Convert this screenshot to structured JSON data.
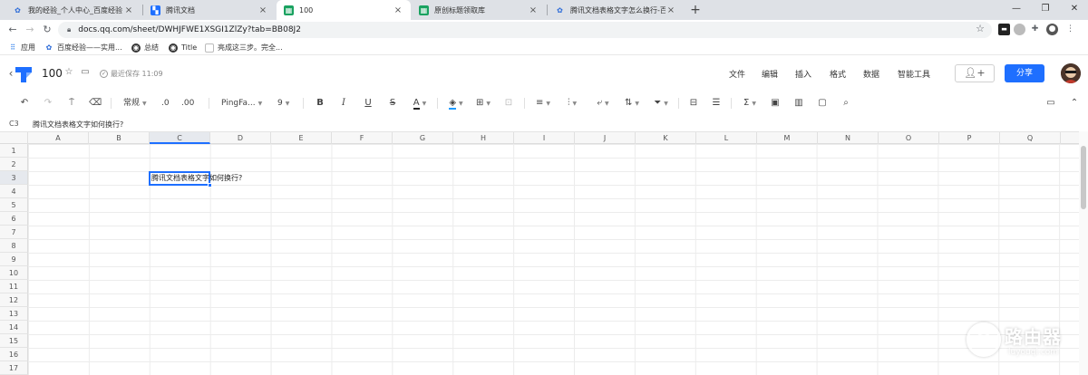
{
  "browser": {
    "tabs": [
      {
        "title": "我的经验_个人中心_百度经验",
        "active": false
      },
      {
        "title": "腾讯文档",
        "active": false
      },
      {
        "title": "100",
        "active": true
      },
      {
        "title": "原创标题领取库",
        "active": false
      },
      {
        "title": "腾讯文档表格文字怎么换行-百度",
        "active": false
      }
    ],
    "url": "docs.qq.com/sheet/DWHJFWE1XSGI1ZlZy?tab=BB08J2",
    "bookmarks": [
      {
        "label": "应用"
      },
      {
        "label": "百度经验——实用..."
      },
      {
        "label": "总结"
      },
      {
        "label": "Title"
      },
      {
        "label": "亮成这三步。完全..."
      }
    ]
  },
  "doc": {
    "title": "100",
    "saved_status": "最近保存 11:09",
    "menus": [
      "文件",
      "编辑",
      "插入",
      "格式",
      "数据",
      "智能工具"
    ],
    "share_label": "分享",
    "accent_color": "#1e6fff"
  },
  "toolbar": {
    "number_format": "常规",
    "decimal_decrease": ".0",
    "decimal_increase": ".00",
    "font_family": "PingFa...",
    "font_size": "9",
    "bold": "B",
    "italic": "I",
    "underline": "U",
    "strike": "S",
    "font_color": "A"
  },
  "formula_bar": {
    "cell_ref": "C3",
    "content": "腾讯文档表格文字如何换行?"
  },
  "sheet": {
    "columns": [
      "A",
      "B",
      "C",
      "D",
      "E",
      "F",
      "G",
      "H",
      "I",
      "J",
      "K",
      "L",
      "M",
      "N",
      "O",
      "P",
      "Q"
    ],
    "rows": [
      "1",
      "2",
      "3",
      "4",
      "5",
      "6",
      "7",
      "8",
      "9",
      "10",
      "11",
      "12",
      "13",
      "14",
      "15",
      "16",
      "17"
    ],
    "selected_column": "C",
    "selected_row": "3",
    "cell_c3": "腾讯文档表格文字如何换行?"
  },
  "watermark": {
    "text": "路由器",
    "url": "luyouqi.com"
  }
}
